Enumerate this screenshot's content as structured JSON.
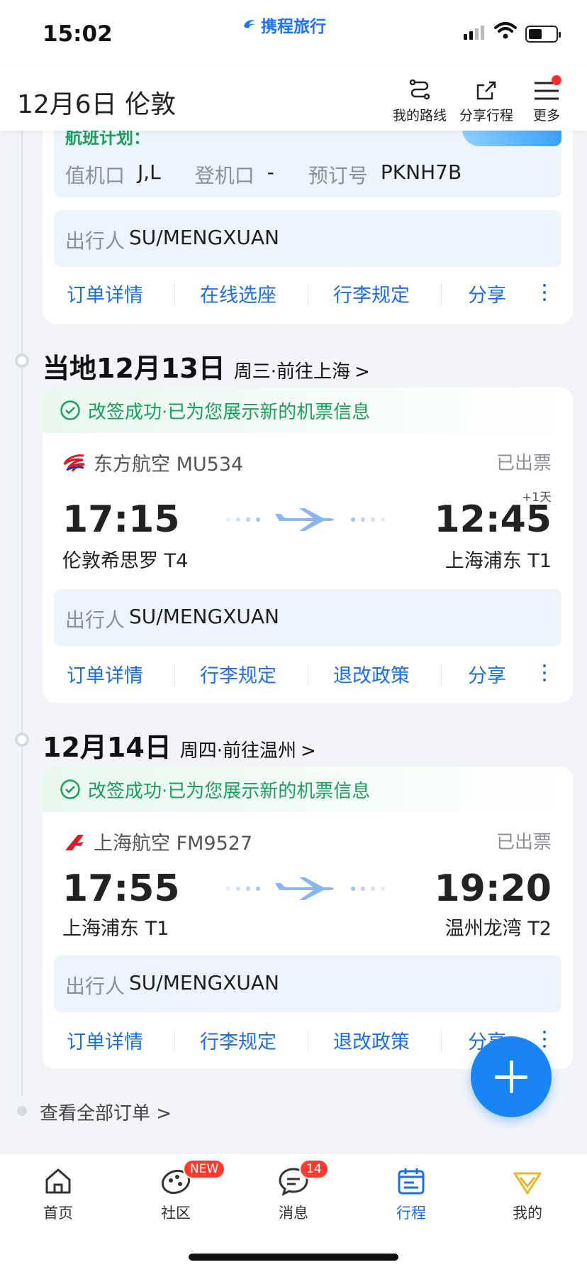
{
  "status": {
    "time": "15:02",
    "brand": "携程旅行"
  },
  "header": {
    "title": "12月6日 伦敦",
    "route_label": "我的路线",
    "share_label": "分享行程",
    "more_label": "更多"
  },
  "top_card": {
    "plan_text": "航班计划：",
    "checkin_label": "值机口",
    "checkin_value": "J,L",
    "gate_label": "登机口",
    "gate_value": "-",
    "booking_label": "预订号",
    "booking_value": "PKNH7B",
    "traveler_label": "出行人",
    "traveler_value": "SU/MENGXUAN",
    "actions": [
      "订单详情",
      "在线选座",
      "行李规定",
      "分享"
    ]
  },
  "day2": {
    "date": "当地12月13日",
    "sub": "周三·前往上海",
    "chevron": ">"
  },
  "flight2": {
    "banner": "改签成功·已为您展示新的机票信息",
    "airline": "东方航空 MU534",
    "status": "已出票",
    "plus_day": "+1天",
    "dep_time": "17:15",
    "dep_place": "伦敦希思罗 T4",
    "arr_time": "12:45",
    "arr_place": "上海浦东 T1",
    "traveler_label": "出行人",
    "traveler_value": "SU/MENGXUAN",
    "actions": [
      "订单详情",
      "行李规定",
      "退改政策",
      "分享"
    ]
  },
  "day3": {
    "date": "12月14日",
    "sub": "周四·前往温州",
    "chevron": ">"
  },
  "flight3": {
    "banner": "改签成功·已为您展示新的机票信息",
    "airline": "上海航空 FM9527",
    "status": "已出票",
    "dep_time": "17:55",
    "dep_place": "上海浦东 T1",
    "arr_time": "19:20",
    "arr_place": "温州龙湾 T2",
    "traveler_label": "出行人",
    "traveler_value": "SU/MENGXUAN",
    "actions": [
      "订单详情",
      "行李规定",
      "退改政策",
      "分享"
    ]
  },
  "view_all": "查看全部订单 >",
  "tabs": [
    {
      "label": "首页",
      "icon": "home-icon"
    },
    {
      "label": "社区",
      "icon": "community-icon",
      "badge": "NEW"
    },
    {
      "label": "消息",
      "icon": "message-icon",
      "badge": "14"
    },
    {
      "label": "行程",
      "icon": "itinerary-icon"
    },
    {
      "label": "我的",
      "icon": "profile-icon"
    }
  ],
  "colors": {
    "accent": "#1a6ee8",
    "success": "#1aa05a",
    "badge": "#ff3b2f",
    "gold": "#e8b530"
  }
}
